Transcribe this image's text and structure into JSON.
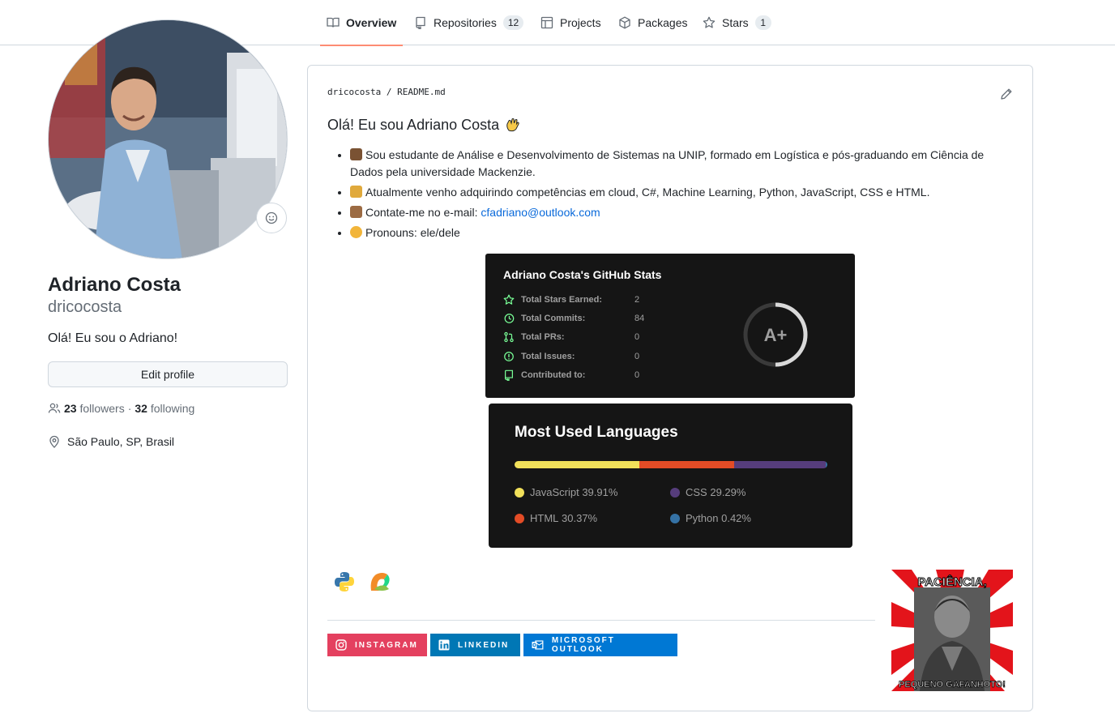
{
  "nav": {
    "tabs": [
      {
        "label": "Overview",
        "icon": "book-icon",
        "active": true
      },
      {
        "label": "Repositories",
        "icon": "repo-icon",
        "count": "12"
      },
      {
        "label": "Projects",
        "icon": "table-icon"
      },
      {
        "label": "Packages",
        "icon": "package-icon"
      },
      {
        "label": "Stars",
        "icon": "star-icon",
        "count": "1"
      }
    ]
  },
  "profile": {
    "name": "Adriano Costa",
    "login": "dricocosta",
    "bio": "Olá! Eu sou o Adriano!",
    "edit_label": "Edit profile",
    "followers_count": "23",
    "followers_label": "followers",
    "separator": "·",
    "following_count": "32",
    "following_label": "following",
    "location": "São Paulo, SP, Brasil"
  },
  "readme": {
    "path_user": "dricocosta",
    "path_sep": "/",
    "path_file": "README.md",
    "title": "Olá! Eu sou Adriano Costa",
    "bullets": [
      "Sou estudante de Análise e Desenvolvimento de Sistemas na UNIP, formado em Logística e pós-graduando em Ciência de Dados pela universidade Mackenzie.",
      "Atualmente venho adquirindo competências em cloud, C#, Machine Learning, Python, JavaScript, CSS e HTML.",
      "Contate-me no e-mail: ",
      "Pronouns: ele/dele"
    ],
    "email": "cfadriano@outlook.com",
    "stats": {
      "title": "Adriano Costa's GitHub Stats",
      "rows": [
        {
          "label": "Total Stars Earned:",
          "value": "2"
        },
        {
          "label": "Total Commits:",
          "value": "84"
        },
        {
          "label": "Total PRs:",
          "value": "0"
        },
        {
          "label": "Total Issues:",
          "value": "0"
        },
        {
          "label": "Contributed to:",
          "value": "0"
        }
      ],
      "grade": "A+",
      "accent": "#79ff97"
    },
    "languages": {
      "title": "Most Used Languages",
      "items": [
        {
          "name": "JavaScript",
          "percent": "39.91%",
          "value": 39.91,
          "color": "#f1e05a"
        },
        {
          "name": "HTML",
          "percent": "30.37%",
          "value": 30.37,
          "color": "#e34c26"
        },
        {
          "name": "CSS",
          "percent": "29.29%",
          "value": 29.29,
          "color": "#563d7c"
        },
        {
          "name": "Python",
          "percent": "0.42%",
          "value": 0.42,
          "color": "#3572A5"
        }
      ]
    },
    "badges": [
      {
        "label": "INSTAGRAM",
        "color": "#E4405F"
      },
      {
        "label": "LINKEDIN",
        "color": "#0077B5"
      },
      {
        "label": "MICROSOFT OUTLOOK",
        "color": "#0078D4"
      }
    ],
    "meme": {
      "top": "PACIÊNCIA,",
      "bottom": "PEQUENO GAFANHOTO!"
    }
  }
}
